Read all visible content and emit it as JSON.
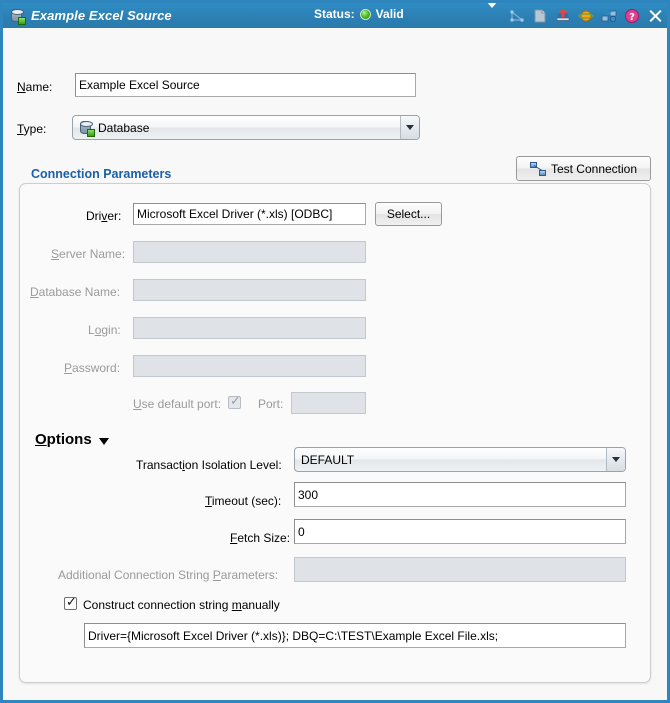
{
  "window": {
    "title": "Example Excel Source",
    "title_icon": "database-icon",
    "status_label": "Status:",
    "status_value": "Valid",
    "status_color": "#4ec22a",
    "titlebar_color": "#2c80b4",
    "toolbar_icons": [
      {
        "name": "dropdown-arrow-icon",
        "glyph": "triangle-down"
      },
      {
        "name": "lineage-graph-icon",
        "glyph": "graph"
      },
      {
        "name": "document-icon",
        "glyph": "document"
      },
      {
        "name": "deploy-icon",
        "glyph": "deploy"
      },
      {
        "name": "sphere-icon",
        "glyph": "sphere"
      },
      {
        "name": "refresh-data-icon",
        "glyph": "refresh"
      },
      {
        "name": "help-icon",
        "glyph": "question"
      },
      {
        "name": "close-icon",
        "glyph": "x"
      }
    ]
  },
  "form": {
    "name_label": "Name:",
    "name_label_mn": "N",
    "name_label_rest": "ame:",
    "name_value": "Example Excel Source",
    "type_label": "Type:",
    "type_label_mn": "T",
    "type_label_rest": "ype:",
    "type_value": "Database",
    "type_icon": "database-icon"
  },
  "connection": {
    "section_title": "Connection Parameters",
    "test_button_label": "Test Connection",
    "test_button_icon": "network-nodes-icon",
    "driver_label_a": "Dri",
    "driver_label_mn": "v",
    "driver_label_b": "er:",
    "driver_value": "Microsoft Excel Driver (*.xls) [ODBC]",
    "select_button_label": "Select...",
    "server_label_mn": "S",
    "server_label_rest": "erver Name:",
    "server_value": "",
    "database_label_mn": "D",
    "database_label_rest": "atabase Name:",
    "database_value": "",
    "login_label_a": "L",
    "login_label_mn": "o",
    "login_label_b": "gin:",
    "login_value": "",
    "password_label_mn": "P",
    "password_label_rest": "assword:",
    "password_value": "",
    "use_default_port_label_mn": "U",
    "use_default_port_label_rest": "se default port:",
    "use_default_port_checked": true,
    "port_label": "Port:",
    "port_value": ""
  },
  "options": {
    "header": "Options",
    "header_mn": "O",
    "header_rest": "ptions",
    "isolation_label_a": "Transact",
    "isolation_label_mn": "i",
    "isolation_label_b": "on Isolation Level:",
    "isolation_value": "DEFAULT",
    "timeout_label_mn": "T",
    "timeout_label_rest": "imeout (sec):",
    "timeout_value": "300",
    "fetch_label_mn": "F",
    "fetch_label_rest": "etch Size:",
    "fetch_value": "0",
    "additional_label_a": "Additional Connection String ",
    "additional_label_mn": "P",
    "additional_label_b": "arameters:",
    "additional_value": "",
    "construct_label_a": "Construct connection string ",
    "construct_label_mn": "m",
    "construct_label_b": "anually",
    "construct_checked": true,
    "connection_string_value": "Driver={Microsoft Excel Driver (*.xls)}; DBQ=C:\\TEST\\Example Excel File.xls;"
  }
}
